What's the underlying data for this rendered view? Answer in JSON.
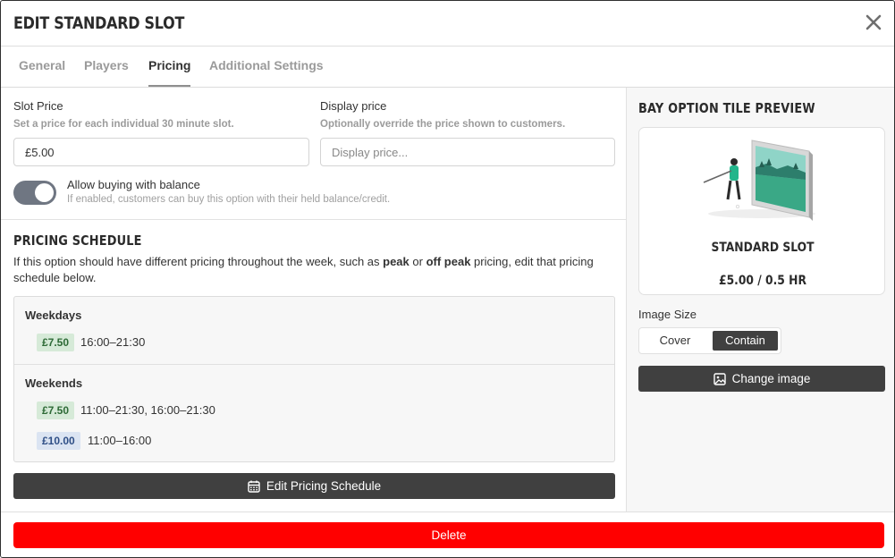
{
  "modal": {
    "title": "EDIT STANDARD SLOT"
  },
  "tabs": [
    {
      "label": "General"
    },
    {
      "label": "Players"
    },
    {
      "label": "Pricing"
    },
    {
      "label": "Additional Settings"
    }
  ],
  "pricing": {
    "slot_price_label": "Slot Price",
    "slot_price_help": "Set a price for each individual 30 minute slot.",
    "slot_price_value": "£5.00",
    "display_price_label": "Display price",
    "display_price_help": "Optionally override the price shown to customers.",
    "display_price_placeholder": "Display price...",
    "balance_toggle_label": "Allow buying with balance",
    "balance_toggle_help": "If enabled, customers can buy this option with their held balance/credit.",
    "balance_toggle_on": true
  },
  "schedule": {
    "title": "PRICING SCHEDULE",
    "desc_part1": "If this option should have different pricing throughout the week, such as ",
    "desc_bold1": "peak",
    "desc_part2": " or ",
    "desc_bold2": "off peak",
    "desc_part3": " pricing, edit that pricing schedule below.",
    "groups": [
      {
        "name": "Weekdays",
        "rows": [
          {
            "price": "£7.50",
            "times": "16:00–21:30",
            "color": "green"
          }
        ]
      },
      {
        "name": "Weekends",
        "rows": [
          {
            "price": "£7.50",
            "times": "11:00–21:30, 16:00–21:30",
            "color": "green"
          },
          {
            "price": "£10.00",
            "times": "11:00–16:00",
            "color": "blue"
          }
        ]
      }
    ],
    "edit_button": "Edit Pricing Schedule"
  },
  "preview": {
    "title": "BAY OPTION TILE PREVIEW",
    "slot_name": "STANDARD SLOT",
    "slot_price": "£5.00 / 0.5 HR",
    "image_size_label": "Image Size",
    "image_size_options": [
      "Cover",
      "Contain"
    ],
    "image_size_selected": "Contain",
    "change_image_button": "Change image"
  },
  "footer": {
    "delete_button": "Delete"
  },
  "colors": {
    "accent_dark": "#404040",
    "danger": "#ff0000",
    "badge_green_bg": "#d6ead8",
    "badge_blue_bg": "#dbe4f2"
  },
  "icons": [
    "close-icon",
    "calendar-icon",
    "image-icon",
    "golfer-simulator-illustration"
  ]
}
